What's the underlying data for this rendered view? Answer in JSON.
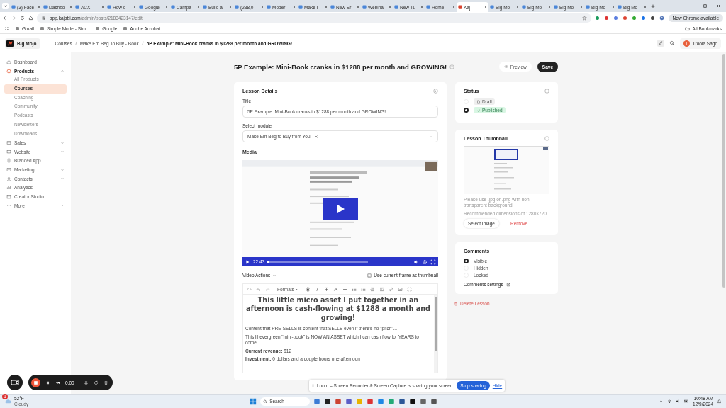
{
  "browser": {
    "tabs": [
      {
        "label": "(3) Face",
        "selected": false
      },
      {
        "label": "Dashbo",
        "selected": false
      },
      {
        "label": "ACX",
        "selected": false
      },
      {
        "label": "How d",
        "selected": false
      },
      {
        "label": "Google",
        "selected": false
      },
      {
        "label": "Campa",
        "selected": false
      },
      {
        "label": "Build a",
        "selected": false
      },
      {
        "label": "(238,0",
        "selected": false
      },
      {
        "label": "Moder",
        "selected": false
      },
      {
        "label": "Make I",
        "selected": false
      },
      {
        "label": "New Sr",
        "selected": false
      },
      {
        "label": "Webina",
        "selected": false
      },
      {
        "label": "New Tu",
        "selected": false
      },
      {
        "label": "Home",
        "selected": false
      },
      {
        "label": "Kaj",
        "selected": true
      },
      {
        "label": "Big Mo",
        "selected": false
      },
      {
        "label": "Big Mo",
        "selected": false
      },
      {
        "label": "Big Mo",
        "selected": false
      },
      {
        "label": "Big Mo",
        "selected": false
      },
      {
        "label": "Big Mo",
        "selected": false
      }
    ],
    "url_host": "app.kajabi.com",
    "url_path": "/admin/posts/2183423147/edit",
    "update": "New Chrome available",
    "bookmarks": [
      "Gmail",
      "Simple Mode - Sim...",
      "Google",
      "Adobe Acrobat"
    ],
    "all_bookmarks": "All Bookmarks"
  },
  "header": {
    "logo": "Big Mojo",
    "breadcrumb": [
      "Courses",
      "Make Em Beg To Buy - Book",
      "5P Example: Mini-Book cranks in $1288 per month and GROWING!"
    ],
    "user_initial": "T",
    "user": "Troola Sago"
  },
  "sidebar": {
    "items": [
      {
        "label": "Dashboard"
      },
      {
        "label": "Products",
        "expanded": true,
        "children": [
          {
            "label": "All Products",
            "selected": false
          },
          {
            "label": "Courses",
            "selected": true
          },
          {
            "label": "Coaching",
            "selected": false
          },
          {
            "label": "Community",
            "selected": false
          },
          {
            "label": "Podcasts",
            "selected": false
          },
          {
            "label": "Newsletters",
            "selected": false
          },
          {
            "label": "Downloads",
            "selected": false
          }
        ]
      },
      {
        "label": "Sales",
        "expanded": false
      },
      {
        "label": "Website",
        "expanded": false
      },
      {
        "label": "Branded App"
      },
      {
        "label": "Marketing",
        "expanded": false
      },
      {
        "label": "Contacts",
        "expanded": false
      },
      {
        "label": "Analytics"
      },
      {
        "label": "Creator Studio"
      },
      {
        "label": "More",
        "expanded": false
      }
    ]
  },
  "page": {
    "title": "5P Example: Mini-Book cranks in $1288 per month and GROWING!",
    "preview": "Preview",
    "save": "Save"
  },
  "lesson_details": {
    "heading": "Lesson Details",
    "title_label": "Title",
    "title_value": "5P Example: Mini-Book cranks in $1288 per month and GROWING!",
    "module_label": "Select module",
    "module_value": "Make Em Beg to Buy from You",
    "media_label": "Media",
    "video": {
      "time": "22:43",
      "level": 0.01
    },
    "video_actions": "Video Actions",
    "use_frame": "Use current frame as thumbnail",
    "editor": {
      "formats": "Formats",
      "heading": "This little micro asset I put together in an afternoon is cash-flowing at $1288 a month and growing!",
      "paragraphs": [
        "Content that PRE-SELLS is content that SELLS even if there's no \"pitch\"...",
        "This lil evergreen \"mini-book\" is NOW AN ASSET which I can cash flow for YEARS to come.",
        "**Current revenue:** $12",
        "**Investment:** 0 dollars and a couple hours one afternoon"
      ]
    }
  },
  "status": {
    "heading": "Status",
    "options": [
      {
        "label": "Draft",
        "selected": false
      },
      {
        "label": "Published",
        "selected": true
      }
    ]
  },
  "thumbnail": {
    "heading": "Lesson Thumbnail",
    "hint": "Please use .jpg or .png with non-transparent background.",
    "dimensions": "Recommended dimensions of 1280×720",
    "select": "Select Image",
    "remove": "Remove"
  },
  "comments": {
    "heading": "Comments",
    "options": [
      {
        "label": "Visible",
        "selected": true
      },
      {
        "label": "Hidden",
        "selected": false
      },
      {
        "label": "Locked",
        "selected": false
      }
    ],
    "settings": "Comments settings"
  },
  "delete": "Delete Lesson",
  "loom": {
    "timer": "0:00",
    "message": "Loom – Screen Recorder & Screen Capture is sharing your screen.",
    "stop": "Stop sharing",
    "hide": "Hide"
  },
  "taskbar": {
    "badge": "1",
    "temp": "52°F",
    "condition": "Cloudy",
    "search": "Search",
    "time": "10:48 AM",
    "date": "12/9/2024"
  }
}
